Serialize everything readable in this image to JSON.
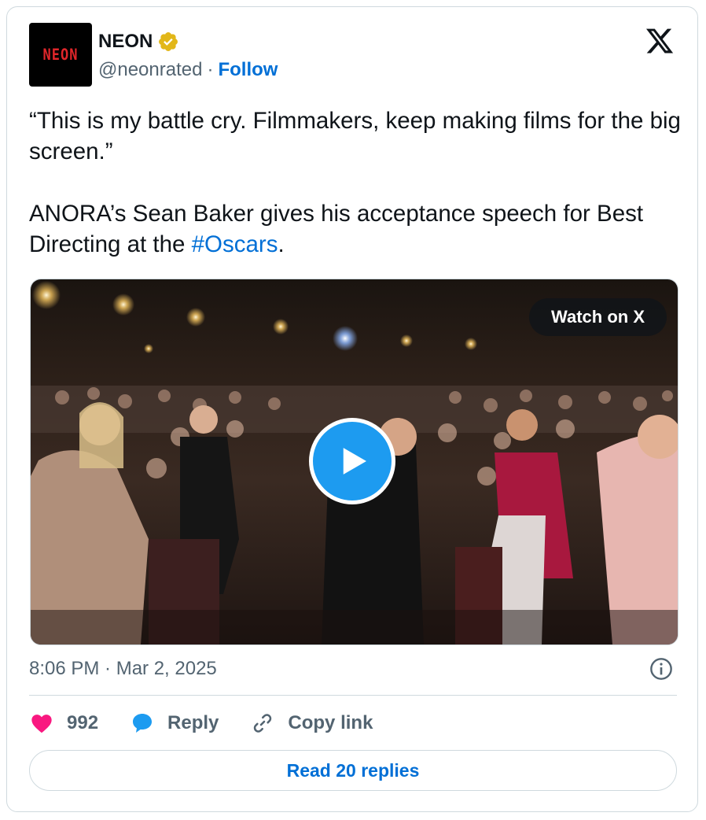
{
  "author": {
    "name": "NEON",
    "handle": "@neonrated",
    "separator": "·",
    "follow_label": "Follow",
    "avatar_text": "NEON",
    "verified_color": "#e2b719"
  },
  "tweet": {
    "line1": "“This is my battle cry. Filmmakers, keep making films for the big screen.”",
    "line2_prefix": "ANORA’s Sean Baker gives his acceptance speech for Best Directing at the ",
    "hashtag": "#Oscars",
    "line2_suffix": "."
  },
  "media": {
    "watch_label": "Watch on X",
    "play_icon": "play-icon"
  },
  "meta": {
    "timestamp": "8:06 PM · Mar 2, 2025"
  },
  "actions": {
    "like_count": "992",
    "reply_label": "Reply",
    "copy_label": "Copy link"
  },
  "footer": {
    "read_replies_label": "Read 20 replies"
  },
  "colors": {
    "link": "#006fd6",
    "like": "#f91880",
    "reply": "#1d9bf0",
    "muted": "#536471"
  }
}
